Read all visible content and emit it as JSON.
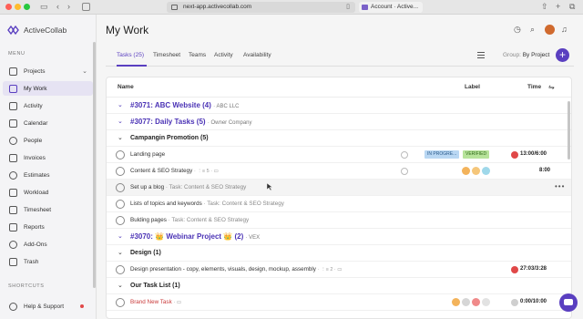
{
  "browser": {
    "url": "next-app.activecollab.com",
    "second_tab": "Account · Active..."
  },
  "sidebar": {
    "logo": "ActiveCollab",
    "menu_heading": "MENU",
    "items": [
      {
        "label": "Projects",
        "icon": "folder-icon"
      },
      {
        "label": "My Work",
        "icon": "user-icon"
      },
      {
        "label": "Activity",
        "icon": "activity-icon"
      },
      {
        "label": "Calendar",
        "icon": "calendar-icon"
      },
      {
        "label": "People",
        "icon": "people-icon"
      },
      {
        "label": "Invoices",
        "icon": "invoice-icon"
      },
      {
        "label": "Estimates",
        "icon": "estimate-icon"
      },
      {
        "label": "Workload",
        "icon": "workload-icon"
      },
      {
        "label": "Timesheet",
        "icon": "timesheet-icon"
      },
      {
        "label": "Reports",
        "icon": "reports-icon"
      },
      {
        "label": "Add-Ons",
        "icon": "addons-icon"
      },
      {
        "label": "Trash",
        "icon": "trash-icon"
      }
    ],
    "shortcuts_heading": "SHORTCUTS",
    "help": "Help & Support"
  },
  "header": {
    "title": "My Work"
  },
  "tabs": {
    "items": [
      "Tasks (25)",
      "Timesheet",
      "Teams",
      "Activity",
      "Availability"
    ],
    "group_label": "Group:",
    "group_value": "By Project"
  },
  "columns": {
    "name": "Name",
    "label": "Label",
    "time": "Time"
  },
  "rows": {
    "p1": {
      "title": "#3071: ABC Website (4)",
      "sub": "ABC LLC"
    },
    "p2": {
      "title": "#3077: Daily Tasks (5)",
      "sub": "Owner Company"
    },
    "g1": {
      "title": "Campangin Promotion (5)"
    },
    "t1": {
      "name": "Landing page",
      "label1": "IN PROGRE...",
      "label2": "VERIFIED",
      "time": "13:00/6:00"
    },
    "t2": {
      "name": "Content & SEO Strategy",
      "meta": "5",
      "time": "8:00"
    },
    "t3": {
      "name": "Set up a blog",
      "meta": "Task: Content & SEO Strategy",
      "more": "•••"
    },
    "t4": {
      "name": "Lists of topics and keywords",
      "meta": "Task: Content & SEO Strategy"
    },
    "t5": {
      "name": "Bulding pages",
      "meta": "Task: Content & SEO Strategy"
    },
    "p3": {
      "title": "#3070: 👑 Webinar Project 👑 (2)",
      "sub": "VEX"
    },
    "g2": {
      "title": "Design (1)"
    },
    "t6": {
      "name": "Design presentation - copy, elements, visuals, design, mockup, assembly",
      "meta": "2",
      "time": "27:03/3:28"
    },
    "g3": {
      "title": "Our Task List (1)"
    },
    "t7": {
      "name": "Brand New Task",
      "time": "0:00/10:00"
    }
  },
  "colors": {
    "accent": "#5a3fc0",
    "in_progress": "#b9d7f3",
    "verified": "#b7e39a",
    "timer_red": "#e04848"
  }
}
